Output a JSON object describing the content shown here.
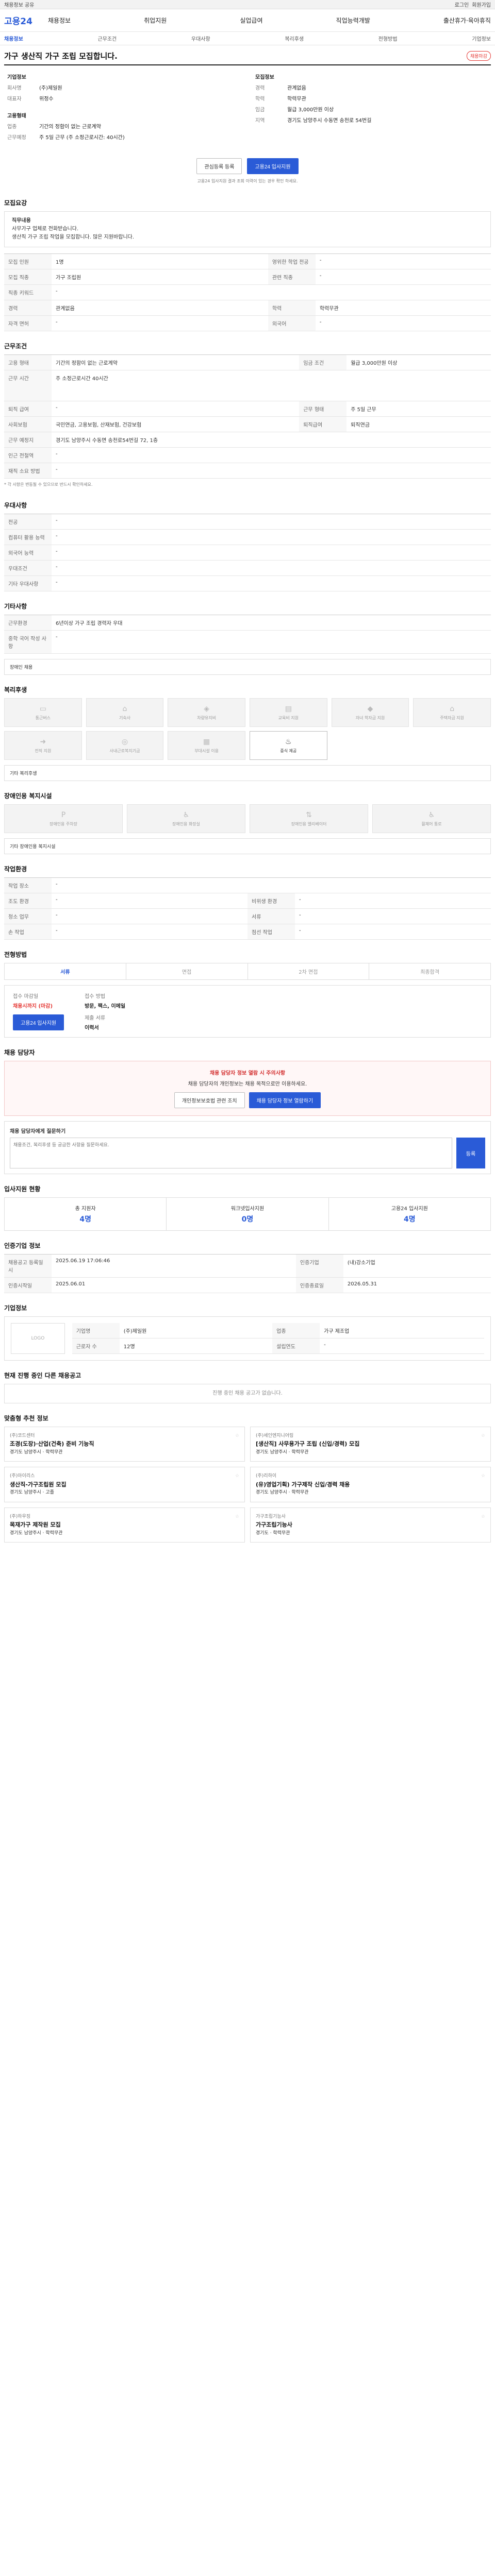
{
  "topbar": {
    "notice": "채용정보 공유",
    "links": [
      "로그인",
      "회원가입"
    ]
  },
  "gnb": {
    "logo": "고용24",
    "menu": [
      "채용정보",
      "취업지원",
      "실업급여",
      "직업능력개발",
      "출산휴가·육아휴직"
    ]
  },
  "lnb": [
    "채용정보",
    "근무조건",
    "우대사항",
    "복리후생",
    "전형방법",
    "기업정보"
  ],
  "job": {
    "title": "가구 생산직 가구 조립 모집합니다.",
    "badge": "채용마감"
  },
  "summary": {
    "company_label": "기업정보",
    "job_label": "모집정보",
    "company": [
      {
        "k": "회사명",
        "v": "(주)제일원"
      },
      {
        "k": "대표자",
        "v": "위정수"
      },
      {
        "k": "업종",
        "v": "가구 제조업"
      },
      {
        "k": "주소",
        "v": "경기도 남양주시"
      }
    ],
    "job": [
      {
        "k": "경력",
        "v": "관계없음"
      },
      {
        "k": "학력",
        "v": "학력무관"
      },
      {
        "k": "임금",
        "v": "월급 3,000만원 이상"
      },
      {
        "k": "지역",
        "v": "경기도 남양주시 수동면 송천로 54번길"
      }
    ],
    "extra": [
      {
        "k": "고용형태",
        "v": "기간의 정함이 없는 근로계약"
      },
      {
        "k": "근무예정",
        "v": "주 5일 근무 (주 소정근로시간: 40시간)"
      }
    ]
  },
  "actions": {
    "scrap": "관심등록 등록",
    "apply": "고용24 입사지원"
  },
  "hint": "고용24 입사지원 결과 조회 이력이 있는 경우 확인 하세요.",
  "desc": {
    "title": "모집요강",
    "head": "직무내용",
    "line1": "사무가구 업체로 전화받습니다.",
    "line2": "생산직 가구 조립 작업을 모집합니다. 많은 지원바랍니다."
  },
  "req": [
    {
      "k": "모집 인원",
      "v": "1명",
      "k2": "영위한 학업 전공",
      "v2": "-"
    },
    {
      "k": "모집 직종",
      "v": "가구 조립원",
      "k2": "관련 직종",
      "v2": "-"
    },
    {
      "k": "직종 키워드",
      "v": "-",
      "k2": "",
      "v2": ""
    },
    {
      "k": "경력",
      "v": "관계없음",
      "k2": "학력",
      "v2": "학력무관"
    },
    {
      "k": "자격 면허",
      "v": "-",
      "k2": "외국어",
      "v2": "-"
    }
  ],
  "cond": {
    "title": "근무조건",
    "rows": [
      {
        "k": "고용 형태",
        "v": "기간의 정함이 없는 근로계약",
        "k2": "임금 조건",
        "v2": "월급 3,000만원 이상"
      },
      {
        "k": "근무 시간",
        "v": "주 소정근로시간 40시간",
        "k2": "",
        "v2": ""
      },
      {
        "k": "퇴직 급여",
        "v": "-",
        "k2": "근무 형태",
        "v2": "주 5일 근무"
      },
      {
        "k": "사회보험",
        "v": "국민연금, 고용보험, 산재보험, 건강보험",
        "k2": "퇴직급여",
        "v2": "퇴직연금"
      },
      {
        "k": "근무 예정지",
        "v": "경기도 남양주시 수동면 송천로54번길 72, 1층",
        "k2": "",
        "v2": ""
      },
      {
        "k": "인근 전철역",
        "v": "-",
        "k2": "",
        "v2": ""
      },
      {
        "k": "재직 소요 방법",
        "v": "-",
        "k2": "",
        "v2": ""
      }
    ],
    "note": "* 각 사항은 변동될 수 있으므로 반드시 확인하세요."
  },
  "pref": {
    "title": "우대사항",
    "rows": [
      {
        "k": "전공",
        "v": "-"
      },
      {
        "k": "컴퓨터 활용 능력",
        "v": "-"
      },
      {
        "k": "외국어 능력",
        "v": "-"
      },
      {
        "k": "우대조건",
        "v": "-"
      },
      {
        "k": "기타 우대사항",
        "v": "-"
      }
    ]
  },
  "etc": {
    "title": "기타사항",
    "rows": [
      {
        "k": "근무환경",
        "v": "6년이상 가구 조립 경력자 우대"
      },
      {
        "k": "중학 국어 작성 사항",
        "v": "-"
      }
    ]
  },
  "etc2": "장애인 채용",
  "welfare": {
    "title": "복리후생",
    "items": [
      "통근버스",
      "기숙사",
      "차량유지비",
      "교육비 지원",
      "자녀 학자금 지원",
      "주택자금 지원",
      "전직 지원",
      "사내근로복지기금",
      "부대시설 이용",
      "중식 제공"
    ],
    "other_label": "기타 복리후생"
  },
  "disab": {
    "title": "장애인용 복지시설",
    "items": [
      "장애인용 주차장",
      "장애인용 화장실",
      "장애인용 엘리베이터",
      "휠체어 통로"
    ],
    "other_label": "기타 장애인용 복지시설"
  },
  "work": {
    "title": "작업환경",
    "rows": [
      {
        "k": "작업 장소",
        "v": "-",
        "k2": "",
        "v2": ""
      },
      {
        "k": "조도 환경",
        "v": "-",
        "k2": "비위생 환경",
        "v2": "-"
      },
      {
        "k": "청소 업무",
        "v": "-",
        "k2": "서류",
        "v2": "-"
      },
      {
        "k": "손 작업",
        "v": "-",
        "k2": "점선 작업",
        "v2": "-"
      }
    ]
  },
  "process": {
    "title": "전형방법",
    "tabs": [
      "서류",
      "면접",
      "2차 면접",
      "최종합격"
    ],
    "period_label": "접수 마감일",
    "period": "채용시까지 (마감)",
    "method_label": "접수 방법",
    "method": "방문, 팩스, 이메일",
    "docs_label": "제출 서류",
    "docs": "이력서",
    "apply_btn": "고용24 입사지원"
  },
  "contact": {
    "title": "채용 담당자",
    "alert": "채용 담당자 정보 열람 시 주의사항",
    "text": "채용 담당자의 개인정보는 채용 목적으로만 이용하세요.",
    "btn1": "개인정보보호법 관련 조치",
    "btn2": "채용 담당자 정보 열람하기"
  },
  "qa": {
    "title": "채용 담당자에게 질문하기",
    "placeholder": "채용조건, 복리후생 등 궁금한 사항을 질문하세요.",
    "submit": "등록"
  },
  "status": {
    "title": "입사지원 현황",
    "items": [
      {
        "k": "총 지원자",
        "v": "4명"
      },
      {
        "k": "워크넷입사지원",
        "v": "0명"
      },
      {
        "k": "고용24 입사지원",
        "v": "4명"
      }
    ]
  },
  "certi": {
    "title": "인증기업 정보",
    "rows": [
      {
        "k": "채용공고 등록일시",
        "v": "2025.06.19 17:06:46",
        "k2": "인증기업",
        "v2": "(내)강소기업"
      },
      {
        "k": "인증시작일",
        "v": "2025.06.01",
        "k2": "인증종료일",
        "v2": "2026.05.31"
      }
    ]
  },
  "comp": {
    "title": "기업정보",
    "logo": "LOGO",
    "items": [
      {
        "k": "기업명",
        "v": "(주)제일원"
      },
      {
        "k": "업종",
        "v": "가구 제조업"
      },
      {
        "k": "근로자 수",
        "v": "12명"
      },
      {
        "k": "설립연도",
        "v": "-"
      }
    ]
  },
  "other_jobs": {
    "title": "현재 진행 중인 다른 채용공고",
    "empty": "진행 중인 채용 공고가 없습니다."
  },
  "rec": {
    "title": "맞춤형 추천 정보",
    "cards": [
      {
        "co": "(주)코드센터",
        "title": "조경(도장)·산업(건축) 준비 기능직",
        "info": "경기도 남양주시 · 학력무관"
      },
      {
        "co": "(주)세인엔지니어링",
        "title": "[생산직] 사무용가구 조립 (신입/경력) 모집",
        "info": "경기도 남양주시 · 학력무관"
      },
      {
        "co": "(주)아이리스",
        "title": "생산직-가구조립원 모집",
        "info": "경기도 남양주시 · 고졸"
      },
      {
        "co": "(주)리하이",
        "title": "(유)영업기획) 가구제작 신입/경력 채용",
        "info": "경기도 남양주시 · 학력무관"
      },
      {
        "co": "(주)하우징",
        "title": "목재가구 제작원 모집",
        "info": "경기도 남양주시 · 학력무관"
      },
      {
        "co": "가구조립기능사",
        "title": "가구조립기능사",
        "info": "경기도 · 학력무관"
      }
    ]
  }
}
